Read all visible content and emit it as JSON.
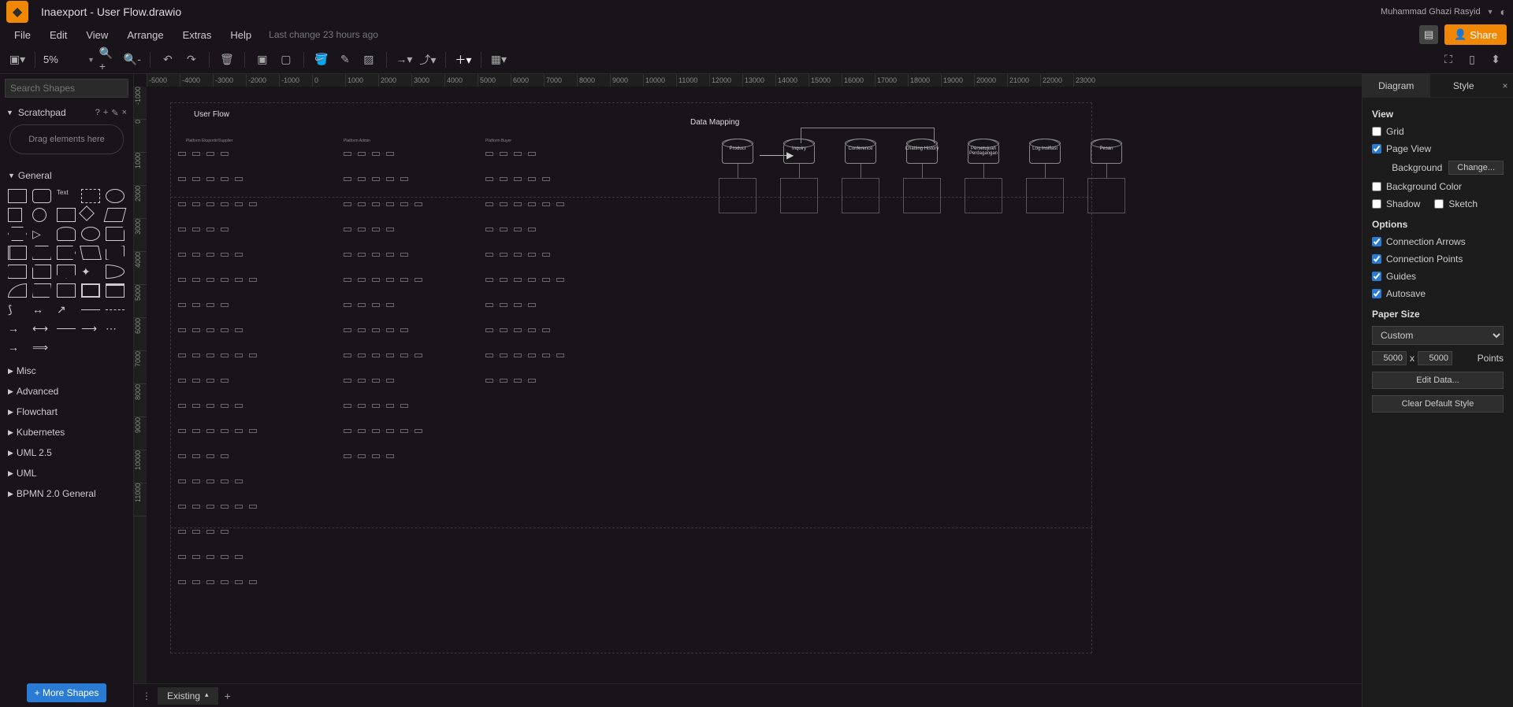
{
  "titlebar": {
    "title": "Inaexport - User Flow.drawio",
    "user": "Muhammad Ghazi Rasyid"
  },
  "menubar": {
    "items": [
      "File",
      "Edit",
      "View",
      "Arrange",
      "Extras",
      "Help"
    ],
    "lastChange": "Last change 23 hours ago",
    "share": "Share"
  },
  "toolbar": {
    "zoom": "5%"
  },
  "sidebarLeft": {
    "searchPlaceholder": "Search Shapes",
    "scratchpad": "Scratchpad",
    "dragHint": "Drag elements here",
    "sections": [
      "General",
      "Misc",
      "Advanced",
      "Flowchart",
      "Kubernetes",
      "UML 2.5",
      "UML",
      "BPMN 2.0 General"
    ],
    "moreShapes": "+ More Shapes"
  },
  "canvas": {
    "rulerH": [
      "-5000",
      "-4000",
      "-3000",
      "-2000",
      "-1000",
      "0",
      "1000",
      "2000",
      "3000",
      "4000",
      "5000",
      "6000",
      "7000",
      "8000",
      "9000",
      "10000",
      "11000",
      "12000",
      "13000",
      "14000",
      "15000",
      "16000",
      "17000",
      "18000",
      "19000",
      "20000",
      "21000",
      "22000",
      "23000"
    ],
    "rulerV": [
      "-1000",
      "0",
      "1000",
      "2000",
      "3000",
      "4000",
      "5000",
      "6000",
      "7000",
      "8000",
      "9000",
      "10000",
      "11000"
    ],
    "labels": {
      "userFlow": "User Flow",
      "dataMapping": "Data Mapping",
      "col1": "Platform Eksportir/Supplier",
      "col2": "Platform Admin",
      "col3": "Platform Buyer"
    },
    "databases": [
      "Product",
      "Inquiry",
      "Conference",
      "Chatting History",
      "Persetujuan Perdagangan",
      "Log Insiflasi",
      "Pesan"
    ]
  },
  "pageTabs": {
    "current": "Existing"
  },
  "rightPanel": {
    "tabs": [
      "Diagram",
      "Style"
    ],
    "view": {
      "heading": "View",
      "grid": "Grid",
      "pageView": "Page View",
      "backgroundLabel": "Background",
      "change": "Change...",
      "bgColor": "Background Color",
      "shadow": "Shadow",
      "sketch": "Sketch"
    },
    "options": {
      "heading": "Options",
      "connArrows": "Connection Arrows",
      "connPoints": "Connection Points",
      "guides": "Guides",
      "autosave": "Autosave"
    },
    "paper": {
      "heading": "Paper Size",
      "preset": "Custom",
      "w": "5000",
      "h": "5000",
      "units": "Points"
    },
    "editData": "Edit Data...",
    "clearStyle": "Clear Default Style"
  }
}
